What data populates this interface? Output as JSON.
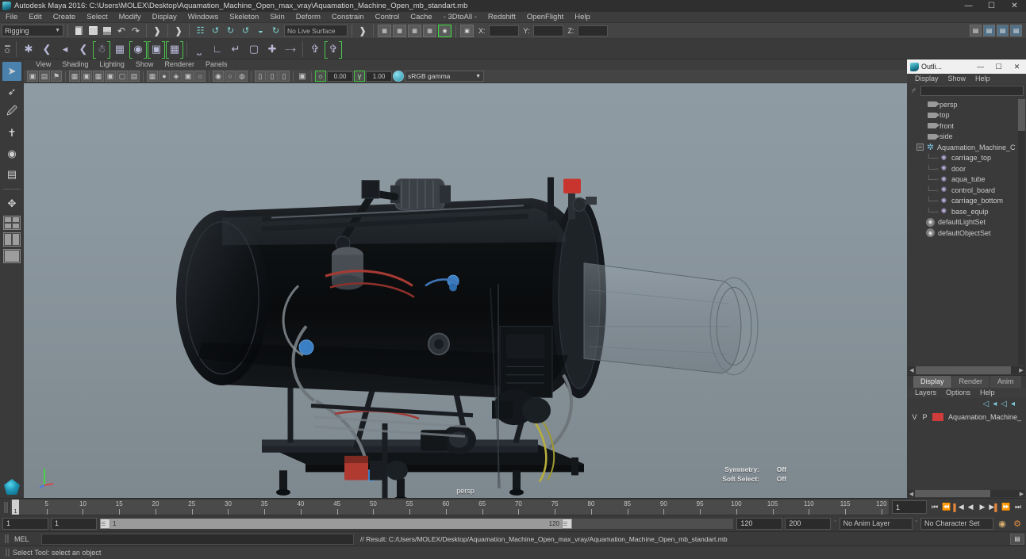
{
  "window": {
    "title": "Autodesk Maya 2016: C:\\Users\\MOLEX\\Desktop\\Aquamation_Machine_Open_max_vray\\Aquamation_Machine_Open_mb_standart.mb",
    "minimize": "—",
    "maximize": "☐",
    "close": "✕",
    "app_icon": "maya-icon"
  },
  "menubar": {
    "items": [
      {
        "label": "File"
      },
      {
        "label": "Edit"
      },
      {
        "label": "Create"
      },
      {
        "label": "Select"
      },
      {
        "label": "Modify"
      },
      {
        "label": "Display"
      },
      {
        "label": "Windows"
      },
      {
        "label": "Skeleton"
      },
      {
        "label": "Skin"
      },
      {
        "label": "Deform"
      },
      {
        "label": "Constrain"
      },
      {
        "label": "Control"
      },
      {
        "label": "Cache"
      },
      {
        "label": "- 3DtoAll -"
      },
      {
        "label": "Redshift"
      },
      {
        "label": "OpenFlight"
      },
      {
        "label": "Help"
      }
    ]
  },
  "status_line": {
    "menu_set": "Rigging",
    "menu_set_caret": "▼",
    "live_surface": "No Live Surface",
    "coord_labels": {
      "x": "X:",
      "y": "Y:",
      "z": "Z:"
    },
    "coord_values": {
      "x": "",
      "y": "",
      "z": ""
    },
    "file_icons": [
      "new-scene-icon",
      "open-scene-icon",
      "save-scene-icon",
      "undo-icon",
      "redo-icon"
    ],
    "snap_icons": [
      "snap-grid-icon",
      "snap-curve-icon",
      "snap-point-icon",
      "snap-projected-icon",
      "snap-view-plane-icon",
      "snap-make-live-icon"
    ],
    "history_icons": [
      "input-connections-icon",
      "output-connections-icon",
      "both-connections-icon",
      "dg-traversal-icon",
      "construction-history-icon"
    ],
    "editor_toggles": [
      "attribute-editor-icon",
      "tool-settings-icon",
      "channel-box-icon",
      "layer-editor-icon"
    ]
  },
  "shelf": {
    "buttons": [
      "joint-tool-icon",
      "ik-handle-icon",
      "ik-spline-icon",
      "ik-rp-icon",
      "quick-rig-icon",
      "bind-skin-icon",
      "interactive-bind-icon",
      "smooth-bind-icon",
      "paint-weights-icon",
      "parent-constraint-icon",
      "point-constraint-icon",
      "orient-constraint-icon",
      "scale-constraint-icon",
      "aim-constraint-icon",
      "pole-vector-icon",
      "mirror-joint-icon",
      "insert-joint-icon"
    ]
  },
  "toolbox": {
    "tools": [
      {
        "name": "select-tool",
        "glyph": "➤",
        "active": true
      },
      {
        "name": "lasso-tool",
        "glyph": "❁",
        "active": false
      },
      {
        "name": "paint-select-tool",
        "glyph": "✎",
        "active": false
      },
      {
        "name": "move-tool",
        "glyph": "✥",
        "active": false
      },
      {
        "name": "rotate-tool",
        "glyph": "◈",
        "active": false
      },
      {
        "name": "scale-tool",
        "glyph": "▣",
        "active": false
      }
    ],
    "layouts": [
      "single-pane-layout",
      "four-pane-layout",
      "two-pane-side-layout",
      "persp-outliner-layout"
    ]
  },
  "viewport": {
    "menus": [
      {
        "label": "View"
      },
      {
        "label": "Shading"
      },
      {
        "label": "Lighting"
      },
      {
        "label": "Show"
      },
      {
        "label": "Renderer"
      },
      {
        "label": "Panels"
      }
    ],
    "toolbar": {
      "exposure_value": "0.00",
      "gamma_value": "1.00",
      "color_profile": "sRGB gamma",
      "color_profile_caret": "▼"
    },
    "camera_label": "persp",
    "hud": [
      {
        "key": "Symmetry:",
        "value": "Off"
      },
      {
        "key": "Soft Select:",
        "value": "Off"
      }
    ],
    "axis_gizmo": {
      "x": "X",
      "y": "Y",
      "z": "Z"
    },
    "scene_subject": "Aquamation machine 3D model"
  },
  "outliner": {
    "title": "Outli...",
    "minimize": "—",
    "maximize": "☐",
    "close": "✕",
    "menus": [
      {
        "label": "Display"
      },
      {
        "label": "Show"
      },
      {
        "label": "Help"
      }
    ],
    "search_value": "",
    "search_placeholder": "",
    "items": [
      {
        "label": "persp",
        "icon": "camera-icon",
        "indent": 1,
        "type": "camera"
      },
      {
        "label": "top",
        "icon": "camera-icon",
        "indent": 1,
        "type": "camera"
      },
      {
        "label": "front",
        "icon": "camera-icon",
        "indent": 1,
        "type": "camera"
      },
      {
        "label": "side",
        "icon": "camera-icon",
        "indent": 1,
        "type": "camera"
      },
      {
        "label": "Aquamation_Machine_C",
        "icon": "group-icon",
        "indent": 0,
        "type": "group",
        "expanded": true
      },
      {
        "label": "carriage_top",
        "icon": "mesh-icon",
        "indent": 2,
        "type": "mesh"
      },
      {
        "label": "door",
        "icon": "mesh-icon",
        "indent": 2,
        "type": "mesh"
      },
      {
        "label": "aqua_tube",
        "icon": "mesh-icon",
        "indent": 2,
        "type": "mesh"
      },
      {
        "label": "control_board",
        "icon": "mesh-icon",
        "indent": 2,
        "type": "mesh"
      },
      {
        "label": "carriage_bottom",
        "icon": "mesh-icon",
        "indent": 2,
        "type": "mesh"
      },
      {
        "label": "base_equip",
        "icon": "mesh-icon",
        "indent": 2,
        "type": "mesh"
      },
      {
        "label": "defaultLightSet",
        "icon": "set-icon",
        "indent": 1,
        "type": "set"
      },
      {
        "label": "defaultObjectSet",
        "icon": "set-icon",
        "indent": 1,
        "type": "set"
      }
    ]
  },
  "layer_editor": {
    "tabs": [
      {
        "label": "Display",
        "active": true
      },
      {
        "label": "Render",
        "active": false
      },
      {
        "label": "Anim",
        "active": false
      }
    ],
    "menus": [
      {
        "label": "Layers"
      },
      {
        "label": "Options"
      },
      {
        "label": "Help"
      }
    ],
    "tool_icons": [
      "new-layer-icon",
      "new-layer-from-selected-icon",
      "move-layer-up-icon",
      "move-layer-down-icon"
    ],
    "columns": {
      "visibility": "V",
      "playback": "P"
    },
    "layers": [
      {
        "visibility": "V",
        "playback": "P",
        "color": "#d03b3b",
        "name": "Aquamation_Machine_"
      }
    ]
  },
  "time_slider": {
    "tick_labels": [
      "5",
      "10",
      "15",
      "20",
      "25",
      "30",
      "35",
      "40",
      "45",
      "50",
      "55",
      "60",
      "65",
      "70",
      "75",
      "80",
      "85",
      "90",
      "95",
      "100",
      "105",
      "110",
      "115",
      "120"
    ],
    "current_frame": "1",
    "current_frame_field": "1",
    "transport": [
      {
        "name": "go-to-start-button",
        "glyph": "⏮"
      },
      {
        "name": "step-back-key-button",
        "glyph": "⏴"
      },
      {
        "name": "step-back-frame-button",
        "glyph": "◀"
      },
      {
        "name": "play-backwards-button",
        "glyph": "◀"
      },
      {
        "name": "play-forwards-button",
        "glyph": "▶"
      },
      {
        "name": "step-forward-frame-button",
        "glyph": "▶"
      },
      {
        "name": "step-forward-key-button",
        "glyph": "⏵"
      },
      {
        "name": "go-to-end-button",
        "glyph": "⏭"
      }
    ]
  },
  "range_slider": {
    "start_field": "1",
    "playback_start_field": "1",
    "bar_start_value": "1",
    "bar_end_value": "120",
    "playback_end_field": "120",
    "end_field": "200",
    "anim_layer": "No Anim Layer",
    "character_set": "No Character Set",
    "caret": "ˇ",
    "key_icon": "auto-keyframe-icon",
    "prefs_icon": "animation-preferences-icon"
  },
  "command_line": {
    "language": "MEL",
    "input_value": "",
    "result_text": "// Result: C:/Users/MOLEX/Desktop/Aquamation_Machine_Open_max_vray/Aquamation_Machine_Open_mb_standart.mb",
    "script_editor_button": "▤"
  },
  "help_line": {
    "text": "Select Tool: select an object"
  }
}
